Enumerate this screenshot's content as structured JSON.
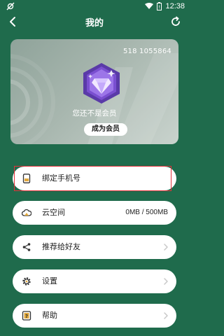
{
  "status_bar": {
    "time": "12:38"
  },
  "header": {
    "title": "我的"
  },
  "card": {
    "user_id": "518 1055864",
    "status_text": "您还不是会员",
    "become_member_label": "成为会员"
  },
  "menu": {
    "items": [
      {
        "label": "绑定手机号",
        "value": "",
        "icon": "phone-icon",
        "has_chevron": false
      },
      {
        "label": "云空间",
        "value": "0MB / 500MB",
        "icon": "cloud-icon",
        "has_chevron": false
      },
      {
        "label": "推荐给好友",
        "value": "",
        "icon": "share-icon",
        "has_chevron": true
      },
      {
        "label": "设置",
        "value": "",
        "icon": "gear-icon",
        "has_chevron": true
      },
      {
        "label": "帮助",
        "value": "",
        "icon": "help-icon",
        "has_chevron": true
      }
    ]
  },
  "colors": {
    "background": "#1f6b4c",
    "highlight_border": "#e2323a",
    "badge_purple": "#7a4fd0"
  }
}
